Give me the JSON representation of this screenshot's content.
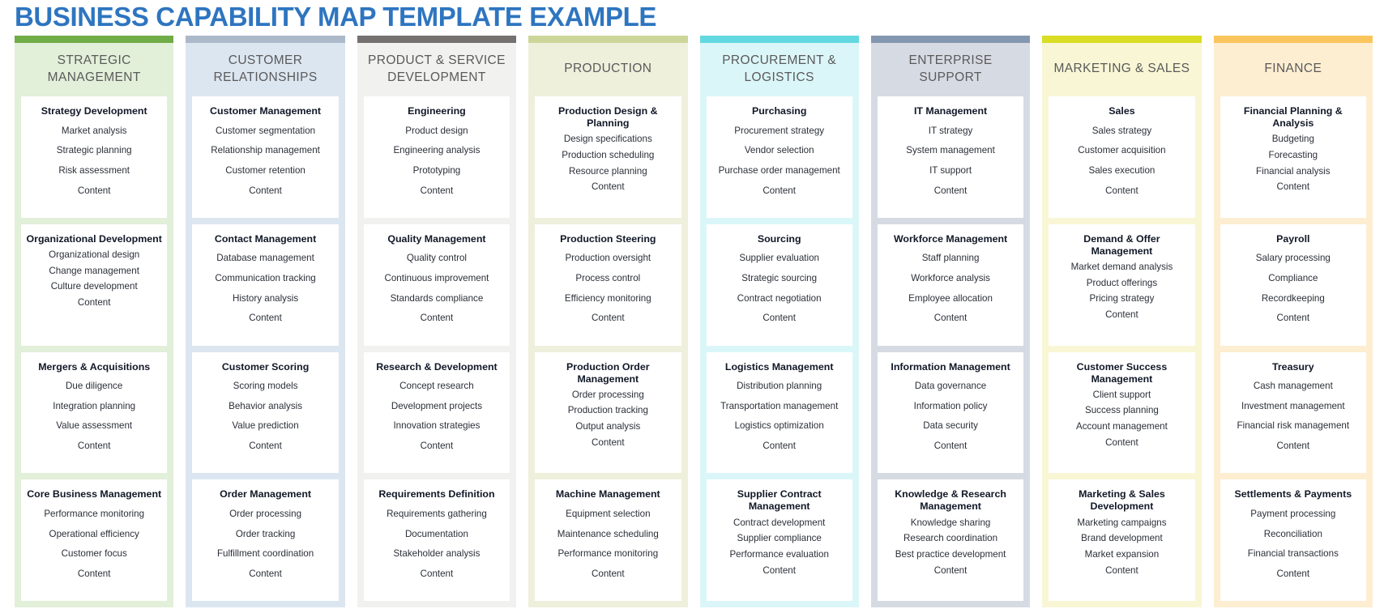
{
  "page": {
    "title": "BUSINESS CAPABILITY MAP TEMPLATE EXAMPLE",
    "title_color": "#2e75c0",
    "background": "#ffffff"
  },
  "columns": [
    {
      "name": "strategic-management",
      "title": "STRATEGIC MANAGEMENT",
      "accent_color": "#70ad47",
      "body_color": "#e2efd9",
      "cards": [
        {
          "title": "Strategy Development",
          "items": [
            "Market analysis",
            "Strategic planning",
            "Risk assessment",
            "Content"
          ]
        },
        {
          "title": "Organizational Development",
          "items": [
            "Organizational design",
            "Change management",
            "Culture development",
            "Content"
          ]
        },
        {
          "title": "Mergers & Acquisitions",
          "items": [
            "Due diligence",
            "Integration planning",
            "Value assessment",
            "Content"
          ]
        },
        {
          "title": "Core Business Management",
          "items": [
            "Performance monitoring",
            "Operational efficiency",
            "Customer focus",
            "Content"
          ]
        }
      ]
    },
    {
      "name": "customer-relationships",
      "title": "CUSTOMER RELATIONSHIPS",
      "accent_color": "#acb9ca",
      "body_color": "#dce6f1",
      "cards": [
        {
          "title": "Customer Management",
          "items": [
            "Customer segmentation",
            "Relationship management",
            "Customer retention",
            "Content"
          ]
        },
        {
          "title": "Contact Management",
          "items": [
            "Database management",
            "Communication tracking",
            "History analysis",
            "Content"
          ]
        },
        {
          "title": "Customer Scoring",
          "items": [
            "Scoring models",
            "Behavior analysis",
            "Value prediction",
            "Content"
          ]
        },
        {
          "title": "Order Management",
          "items": [
            "Order processing",
            "Order tracking",
            "Fulfillment coordination",
            "Content"
          ]
        }
      ]
    },
    {
      "name": "product-service-development",
      "title": "PRODUCT & SERVICE DEVELOPMENT",
      "accent_color": "#767171",
      "body_color": "#f1f1f0",
      "cards": [
        {
          "title": "Engineering",
          "items": [
            "Product design",
            "Engineering analysis",
            "Prototyping",
            "Content"
          ]
        },
        {
          "title": "Quality Management",
          "items": [
            "Quality control",
            "Continuous improvement",
            "Standards compliance",
            "Content"
          ]
        },
        {
          "title": "Research & Development",
          "items": [
            "Concept research",
            "Development projects",
            "Innovation strategies",
            "Content"
          ]
        },
        {
          "title": "Requirements Definition",
          "items": [
            "Requirements gathering",
            "Documentation",
            "Stakeholder analysis",
            "Content"
          ]
        }
      ]
    },
    {
      "name": "production",
      "title": "PRODUCTION",
      "accent_color": "#cdd69a",
      "body_color": "#eef0dc",
      "cards": [
        {
          "title": "Production Design & Planning",
          "items": [
            "Design specifications",
            "Production scheduling",
            "Resource planning",
            "Content"
          ]
        },
        {
          "title": "Production Steering",
          "items": [
            "Production oversight",
            "Process control",
            "Efficiency monitoring",
            "Content"
          ]
        },
        {
          "title": "Production Order Management",
          "items": [
            "Order processing",
            "Production tracking",
            "Output analysis",
            "Content"
          ]
        },
        {
          "title": "Machine Management",
          "items": [
            "Equipment selection",
            "Maintenance scheduling",
            "Performance monitoring",
            "Content"
          ]
        }
      ]
    },
    {
      "name": "procurement-logistics",
      "title": "PROCUREMENT & LOGISTICS",
      "accent_color": "#62d8e0",
      "body_color": "#dbf6f8",
      "cards": [
        {
          "title": "Purchasing",
          "items": [
            "Procurement strategy",
            "Vendor selection",
            "Purchase order management",
            "Content"
          ]
        },
        {
          "title": "Sourcing",
          "items": [
            "Supplier evaluation",
            "Strategic sourcing",
            "Contract negotiation",
            "Content"
          ]
        },
        {
          "title": "Logistics Management",
          "items": [
            "Distribution planning",
            "Transportation management",
            "Logistics optimization",
            "Content"
          ]
        },
        {
          "title": "Supplier Contract Management",
          "items": [
            "Contract development",
            "Supplier compliance",
            "Performance evaluation",
            "Content"
          ]
        }
      ]
    },
    {
      "name": "enterprise-support",
      "title": "ENTERPRISE SUPPORT",
      "accent_color": "#8497b0",
      "body_color": "#d6dae3",
      "cards": [
        {
          "title": "IT Management",
          "items": [
            "IT strategy",
            "System management",
            "IT support",
            "Content"
          ]
        },
        {
          "title": "Workforce Management",
          "items": [
            "Staff planning",
            "Workforce analysis",
            "Employee allocation",
            "Content"
          ]
        },
        {
          "title": "Information Management",
          "items": [
            "Data governance",
            "Information policy",
            "Data security",
            "Content"
          ]
        },
        {
          "title": "Knowledge & Research Management",
          "items": [
            "Knowledge sharing",
            "Research coordination",
            "Best practice development",
            "Content"
          ]
        }
      ]
    },
    {
      "name": "marketing-sales",
      "title": "MARKETING & SALES",
      "accent_color": "#d9dd24",
      "body_color": "#f8f6d5",
      "cards": [
        {
          "title": "Sales",
          "items": [
            "Sales strategy",
            "Customer acquisition",
            "Sales execution",
            "Content"
          ]
        },
        {
          "title": "Demand & Offer Management",
          "items": [
            "Market demand analysis",
            "Product offerings",
            "Pricing strategy",
            "Content"
          ]
        },
        {
          "title": "Customer Success Management",
          "items": [
            "Client support",
            "Success planning",
            "Account management",
            "Content"
          ]
        },
        {
          "title": "Marketing & Sales Development",
          "items": [
            "Marketing campaigns",
            "Brand development",
            "Market expansion",
            "Content"
          ]
        }
      ]
    },
    {
      "name": "finance",
      "title": "FINANCE",
      "accent_color": "#fbc55d",
      "body_color": "#fdeed2",
      "cards": [
        {
          "title": "Financial Planning & Analysis",
          "items": [
            "Budgeting",
            "Forecasting",
            "Financial analysis",
            "Content"
          ]
        },
        {
          "title": "Payroll",
          "items": [
            "Salary processing",
            "Compliance",
            "Recordkeeping",
            "Content"
          ]
        },
        {
          "title": "Treasury",
          "items": [
            "Cash management",
            "Investment management",
            "Financial risk management",
            "Content"
          ]
        },
        {
          "title": "Settlements & Payments",
          "items": [
            "Payment processing",
            "Reconciliation",
            "Financial transactions",
            "Content"
          ]
        }
      ]
    }
  ]
}
